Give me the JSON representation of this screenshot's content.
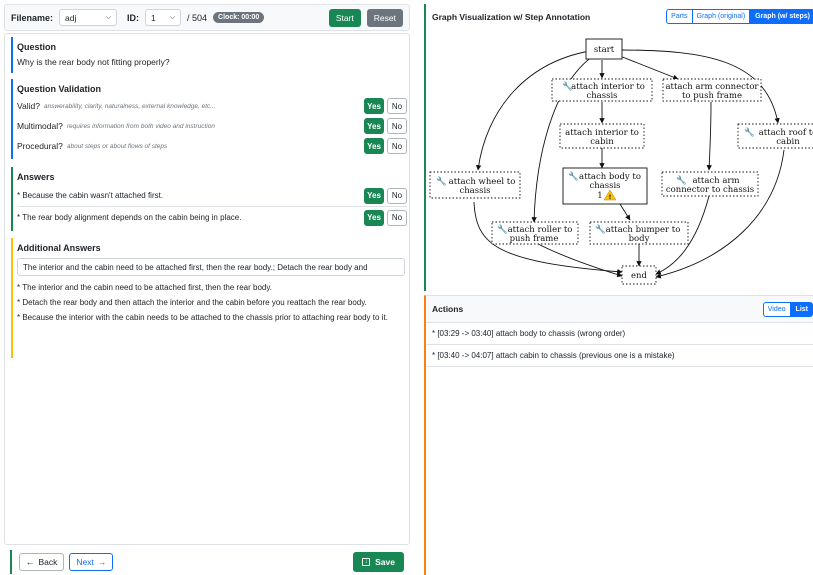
{
  "topbar": {
    "filename_label": "Filename:",
    "filename_value": "adj",
    "id_label": "ID:",
    "id_value": "1",
    "id_total": "/ 504",
    "clock": "Clock: 00:00",
    "start_label": "Start",
    "reset_label": "Reset"
  },
  "question": {
    "title": "Question",
    "text": "Why is the rear body not fitting properly?"
  },
  "validation": {
    "title": "Question Validation",
    "rows": [
      {
        "label": "Valid?",
        "desc": "answerability, clarity, naturalness, external knowledge, etc...",
        "yes": "Yes",
        "no": "No"
      },
      {
        "label": "Multimodal?",
        "desc": "requires information from both video and instruction",
        "yes": "Yes",
        "no": "No"
      },
      {
        "label": "Procedural?",
        "desc": "about steps or about flows of steps",
        "yes": "Yes",
        "no": "No"
      }
    ]
  },
  "answers": {
    "title": "Answers",
    "items": [
      {
        "text": "* Because the cabin wasn't attached first.",
        "yes": "Yes",
        "no": "No"
      },
      {
        "text": "* The rear body alignment depends on the cabin being in place.",
        "yes": "Yes",
        "no": "No"
      }
    ]
  },
  "additional": {
    "title": "Additional Answers",
    "input_value": "The interior and the cabin need to be attached first, then the rear body.; Detach the rear body and",
    "items": [
      "* The interior and the cabin need to be attached first, then the rear body.",
      "* Detach the rear body and then attach the interior and the cabin before you reattach the rear body.",
      "* Because the interior with the cabin needs to be attached to the chassis prior to attaching rear body to it."
    ]
  },
  "bottombar": {
    "back_label": "Back",
    "next_label": "Next",
    "save_label": "Save"
  },
  "graph_panel": {
    "title": "Graph Visualization w/ Step Annotation",
    "tabs": [
      "Parts",
      "Graph (original)",
      "Graph (w/ steps)"
    ],
    "active_tab": "Graph (w/ steps)",
    "nodes": {
      "start": "start",
      "end": "end",
      "interior_to_chassis": [
        "attach interior to",
        "chassis"
      ],
      "arm_to_push": [
        "attach arm connector",
        "to push frame"
      ],
      "roof_to_cabin": [
        "attach roof to",
        "cabin"
      ],
      "interior_to_cabin": [
        "attach interior to",
        "cabin"
      ],
      "wheel_to_chassis": [
        "attach wheel to",
        "chassis"
      ],
      "body_to_chassis": [
        "attach body to",
        "chassis",
        "1"
      ],
      "arm_to_chassis": [
        "attach arm",
        "connector to chassis"
      ],
      "roller_to_push": [
        "attach roller to",
        "push frame"
      ],
      "bumper_to_body": [
        "attach bumper to",
        "body"
      ]
    }
  },
  "actions_panel": {
    "title": "Actions",
    "tabs": [
      "Video",
      "List"
    ],
    "active_tab": "List",
    "items": [
      "* [03:29 -> 03:40] attach body to chassis (wrong order)",
      "* [03:40 -> 04:07] attach cabin to chassis (previous one is a mistake)"
    ]
  },
  "colors": {
    "green": "#198754",
    "blue": "#0d6efd",
    "orange": "#fd7e14",
    "yellow": "#ffc107",
    "question_bar": "#0d6efd",
    "validation_bar": "#0d6efd",
    "answers_bar": "#198754",
    "additional_bar": "#ffc107"
  }
}
